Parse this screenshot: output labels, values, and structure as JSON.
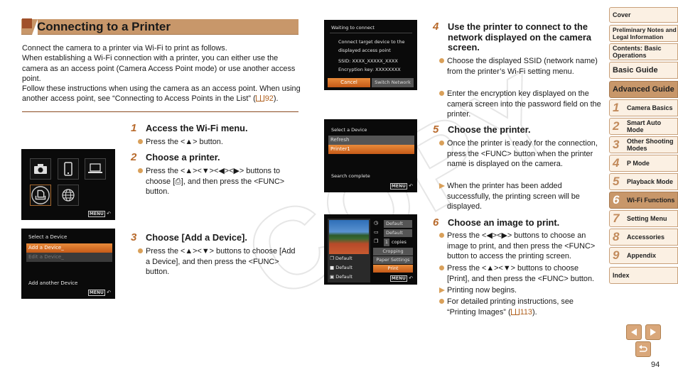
{
  "title": "Connecting to a Printer",
  "intro": {
    "p1": "Connect the camera to a printer via Wi-Fi to print as follows.",
    "p2": "When establishing a Wi-Fi connection with a printer, you can either use the camera as an access point (Camera Access Point mode) or use another access point.",
    "p3": "Follow these instructions when using the camera as an access point. When using another access point, see “Connecting to Access Points in the List” (",
    "p3_ref": "92",
    "p3_end": ")."
  },
  "steps": [
    {
      "num": "1",
      "heading": "Access the Wi-Fi menu.",
      "bullets": [
        "Press the <▲> button."
      ]
    },
    {
      "num": "2",
      "heading": "Choose a printer.",
      "bullets": [
        "Press the <▲><▼><◀><▶> buttons to choose [⎙], and then press the <FUNC> button."
      ]
    },
    {
      "num": "3",
      "heading": "Choose [Add a Device].",
      "bullets": [
        "Press the <▲><▼> buttons to choose [Add a Device], and then press the <FUNC> button."
      ]
    },
    {
      "num": "4",
      "heading": "Use the printer to connect to the network displayed on the camera screen.",
      "bullets": [
        "Choose the displayed SSID (network name) from the printer’s Wi-Fi setting menu.",
        "Enter the encryption key displayed on the camera screen into the password field on the printer."
      ]
    },
    {
      "num": "5",
      "heading": "Choose the printer.",
      "bullets": [
        "Once the printer is ready for the connection, press the <FUNC> button when the printer name is displayed on the camera.",
        "When the printer has been added successfully, the printing screen will be displayed."
      ]
    },
    {
      "num": "6",
      "heading": "Choose an image to print.",
      "bullets": [
        "Press the <◀><▶> buttons to choose an image to print, and then press the <FUNC> button to access the printing screen.",
        "Press the <▲><▼> buttons to choose [Print], and then press the <FUNC> button.",
        "Printing now begins.",
        "For detailed printing instructions, see “Printing Images” (",
        "113",
        ")."
      ]
    }
  ],
  "screens": {
    "wifi_menu": {
      "menu_label": "MENU"
    },
    "select_device_1": {
      "title": "Select a Device",
      "items": [
        "Add a Device_",
        "Edit a Device_"
      ],
      "footer": "Add another Device",
      "menu_label": "MENU"
    },
    "waiting": {
      "title": "Waiting to connect",
      "line1": "Connect target device to the",
      "line2": "displayed access point",
      "ssid": "SSID:  XXXX_XXXXX_XXXX",
      "key": "Encryption key:  XXXXXXXX",
      "cancel": "Cancel",
      "switch": "Switch Network"
    },
    "select_device_2": {
      "title": "Select a Device",
      "items": [
        "Refresh",
        "Printer1"
      ],
      "footer": "Search complete",
      "menu_label": "MENU"
    },
    "print": {
      "opt1": "Default",
      "opt2": "Default",
      "copies_num": "1",
      "copies": "copies",
      "cropping": "Cropping",
      "paper": "Paper Settings",
      "print": "Print",
      "left1": "Default",
      "left2": "Default",
      "left3": "Default",
      "menu_label": "MENU"
    }
  },
  "sidebar": {
    "items": [
      {
        "label": "Cover"
      },
      {
        "label": "Preliminary Notes and Legal Information"
      },
      {
        "label": "Contents: Basic Operations"
      },
      {
        "label": "Basic Guide"
      },
      {
        "label": "Advanced Guide"
      },
      {
        "num": "1",
        "label": "Camera Basics"
      },
      {
        "num": "2",
        "label": "Smart Auto Mode"
      },
      {
        "num": "3",
        "label": "Other Shooting Modes"
      },
      {
        "num": "4",
        "label": "P Mode"
      },
      {
        "num": "5",
        "label": "Playback Mode"
      },
      {
        "num": "6",
        "label": "Wi-Fi Functions"
      },
      {
        "num": "7",
        "label": "Setting Menu"
      },
      {
        "num": "8",
        "label": "Accessories"
      },
      {
        "num": "9",
        "label": "Appendix"
      },
      {
        "label": "Index"
      }
    ]
  },
  "watermark": "COPY",
  "page_number": "94"
}
